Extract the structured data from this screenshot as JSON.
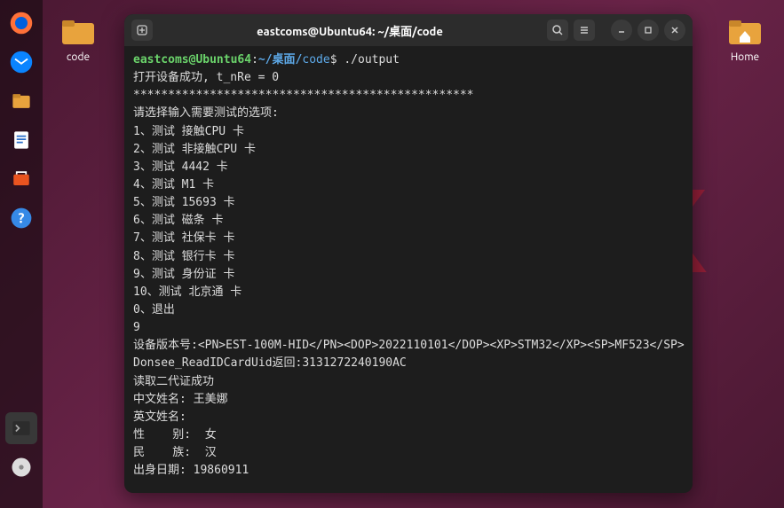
{
  "dock": {
    "items": [
      "firefox",
      "thunderbird",
      "files",
      "libreoffice-writer",
      "software",
      "help",
      "terminal",
      "disc"
    ]
  },
  "desktop": {
    "code_folder_label": "code",
    "home_folder_label": "Home"
  },
  "watermark_text": "Linux",
  "window": {
    "title": "eastcoms@Ubuntu64: ~/桌面/code"
  },
  "terminal": {
    "prompt_user": "eastcoms@Ubuntu64",
    "prompt_colon": ":",
    "prompt_tilde": "~",
    "prompt_path": "/桌面/",
    "prompt_dir": "code",
    "prompt_dollar": "$ ",
    "command": "./output",
    "lines": {
      "l1": "打开设备成功, t_nRe = 0",
      "l2": "*************************************************",
      "l3": "请选择输入需要测试的选项:",
      "l4": "1、测试 接触CPU 卡",
      "l5": "2、测试 非接触CPU 卡",
      "l6": "3、测试 4442 卡",
      "l7": "4、测试 M1 卡",
      "l8": "5、测试 15693 卡",
      "l9": "6、测试 磁条 卡",
      "l10": "7、测试 社保卡 卡",
      "l11": "8、测试 银行卡 卡",
      "l12": "9、测试 身份证 卡",
      "l13": "10、测试 北京通 卡",
      "l14": "0、退出",
      "l15": "9",
      "l16": "设备版本号:<PN>EST-100M-HID</PN><DOP>2022110101</DOP><XP>STM32</XP><SP>MF523</SP>",
      "l17": "Donsee_ReadIDCardUid返回:3131272240190AC",
      "l18": "读取二代证成功",
      "l19": "中文姓名: 王美娜",
      "l20": "英文姓名:",
      "l21": "性    别:  女",
      "l22": "民    族:  汉",
      "l23": "出身日期: 19860911"
    }
  }
}
